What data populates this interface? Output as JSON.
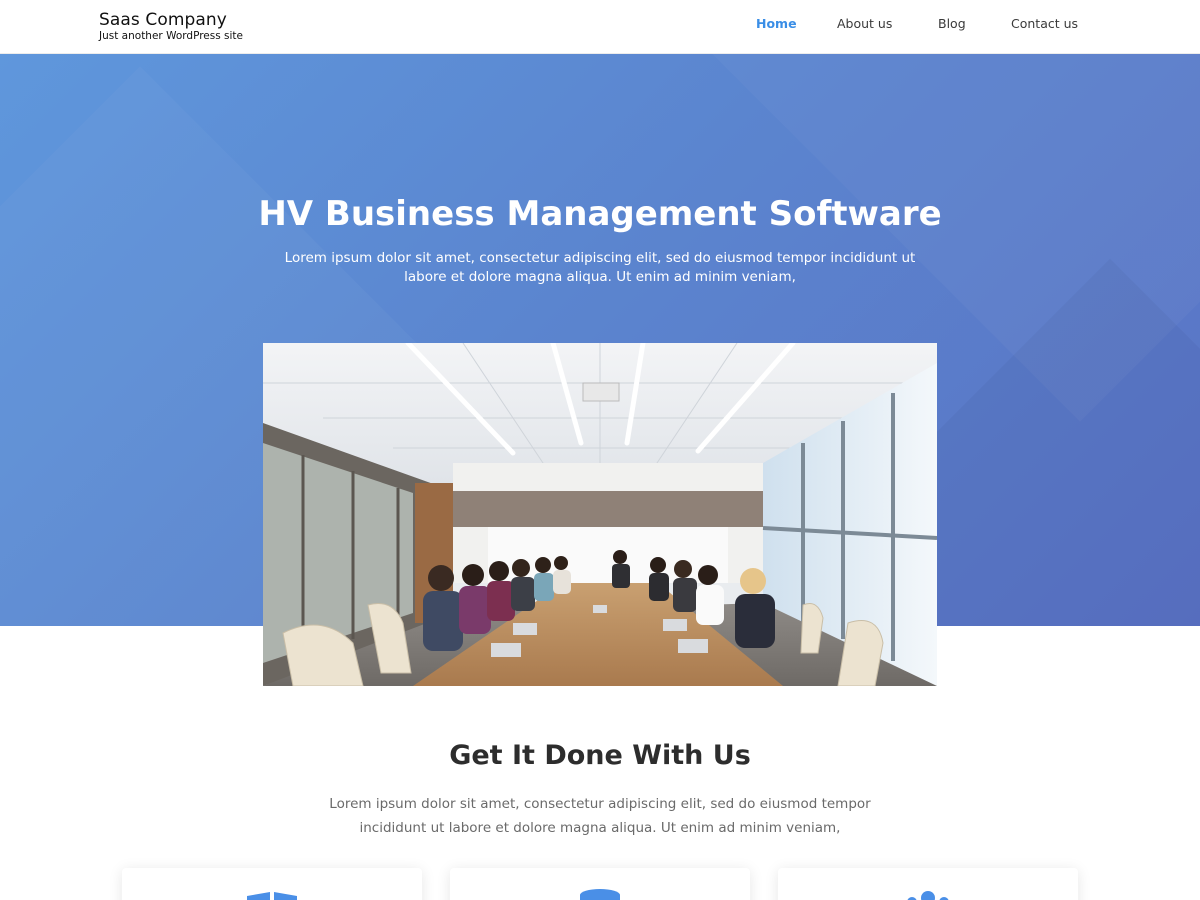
{
  "site": {
    "title": "Saas Company",
    "tagline": "Just another WordPress site"
  },
  "nav": {
    "items": [
      {
        "label": "Home",
        "active": true
      },
      {
        "label": "About us",
        "active": false
      },
      {
        "label": "Blog",
        "active": false
      },
      {
        "label": "Contact us",
        "active": false
      }
    ]
  },
  "hero": {
    "title": "HV Business Management Software",
    "text": "Lorem ipsum dolor sit amet, consectetur adipiscing elit, sed do eiusmod tempor incididunt ut labore et dolore magna aliqua. Ut enim ad minim veniam,",
    "image": "meeting-room-photo"
  },
  "section": {
    "title": "Get It Done With Us",
    "text": "Lorem ipsum dolor sit amet, consectetur adipiscing elit, sed do eiusmod tempor incididunt ut labore et dolore magna aliqua. Ut enim ad minim veniam,"
  },
  "features": [
    {
      "icon": "book-icon"
    },
    {
      "icon": "database-icon"
    },
    {
      "icon": "users-icon"
    }
  ],
  "colors": {
    "accent": "#3a8ee6",
    "hero_start": "#5f97dc",
    "hero_end": "#5a72c4",
    "icon": "#4a8fe7"
  }
}
